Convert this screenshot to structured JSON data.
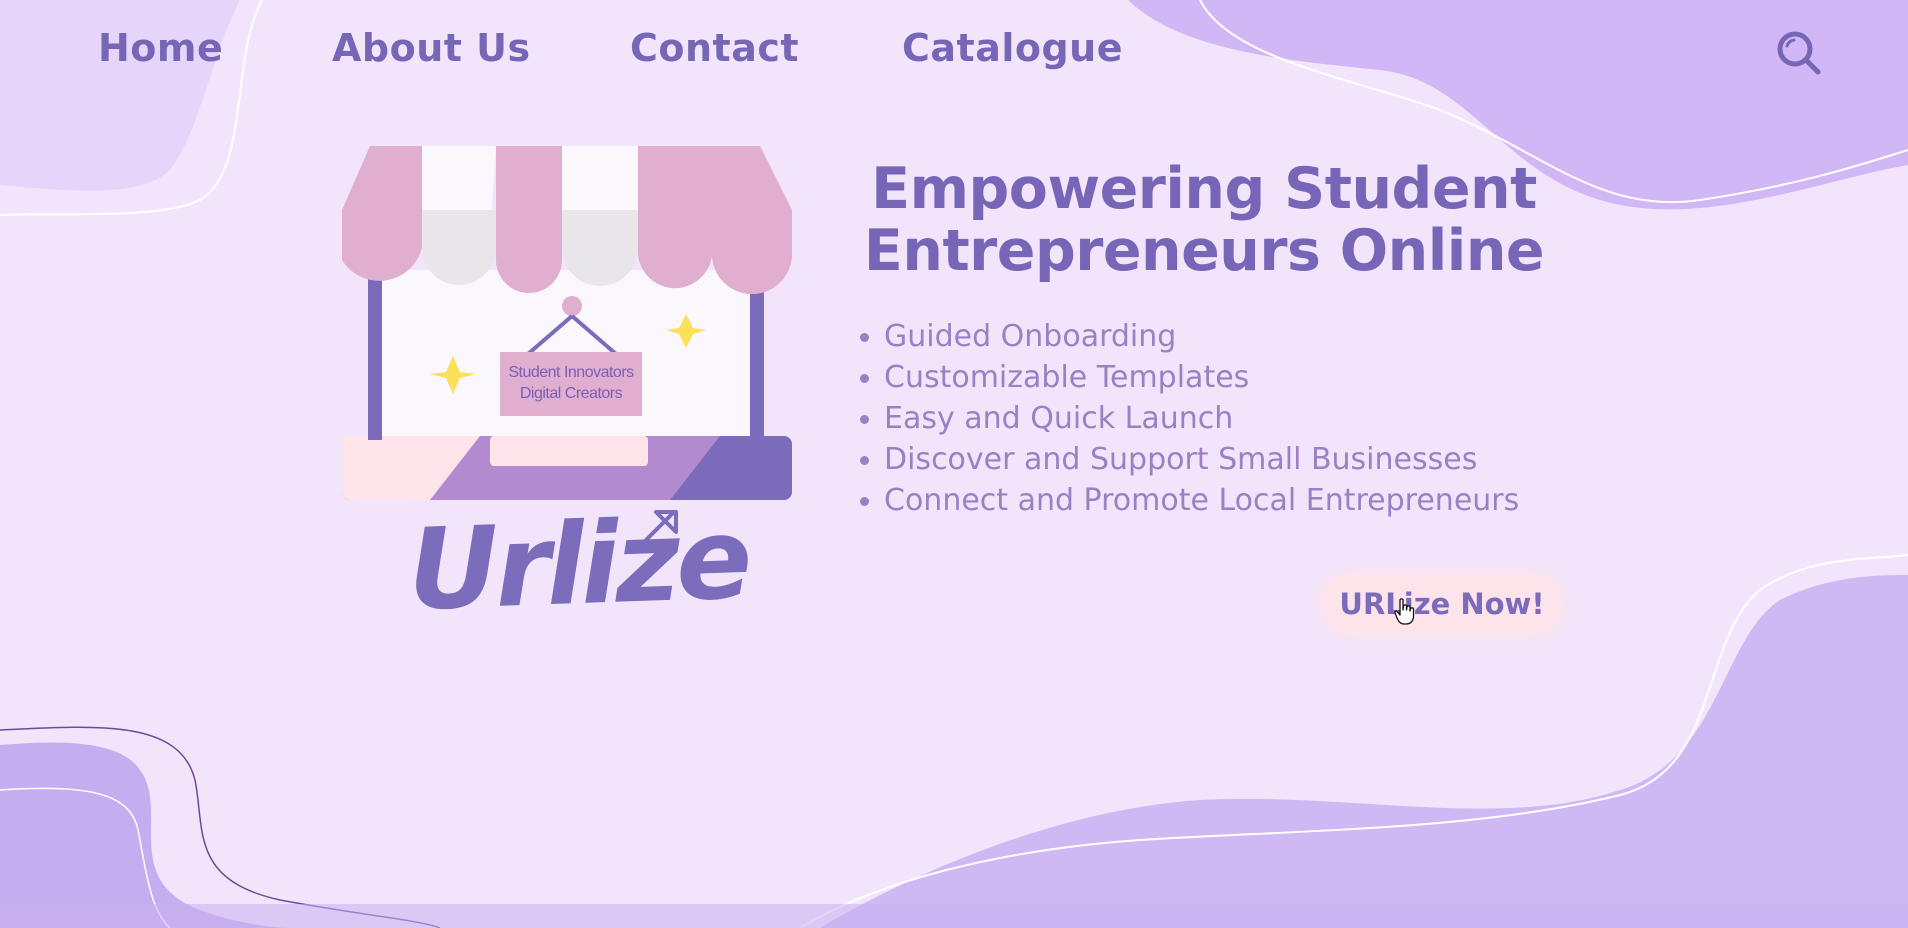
{
  "nav": {
    "home": "Home",
    "about": "About Us",
    "contact": "Contact",
    "catalogue": "Catalogue"
  },
  "search": {
    "icon": "search-icon"
  },
  "hero": {
    "headline_line1": "Empowering Student",
    "headline_line2": "Entrepreneurs Online",
    "features": [
      "Guided Onboarding",
      "Customizable Templates",
      "Easy and Quick Launch",
      "Discover and Support Small Businesses",
      "Connect and Promote Local Entrepreneurs"
    ],
    "cta_label": "URLize Now!"
  },
  "illustration": {
    "sign_line1": "Student Innovators",
    "sign_line2": "Digital Creators",
    "logo_text": "Urlize"
  },
  "colors": {
    "background": "#f2e5fb",
    "primary_purple": "#7567b6",
    "blob_purple": "#cdb7f4",
    "awning_pink": "#e0aecf",
    "cta_background": "#fde3ea",
    "sparkle_yellow": "#fbe05a"
  }
}
